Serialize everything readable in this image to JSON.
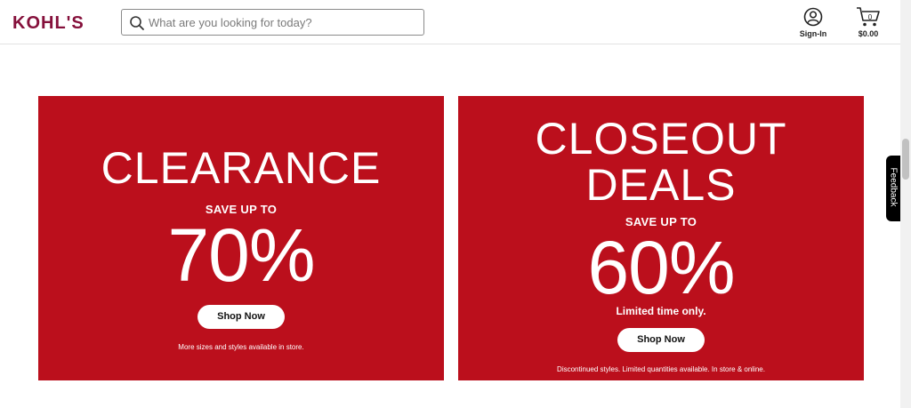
{
  "header": {
    "logo_text": "KOHL'S",
    "search_placeholder": "What are you looking for today?",
    "search_value": "",
    "signin_label": "Sign-In",
    "cart_count": "0",
    "cart_total": "$0.00"
  },
  "promos": [
    {
      "headline_lines": [
        "CLEARANCE"
      ],
      "save_label": "SAVE UP TO",
      "percent": "70%",
      "sub_label": "",
      "button_label": "Shop Now",
      "fine_print": "More sizes and styles available in store."
    },
    {
      "headline_lines": [
        "CLOSEOUT",
        "DEALS"
      ],
      "save_label": "SAVE UP TO",
      "percent": "60%",
      "sub_label": "Limited time only.",
      "button_label": "Shop Now",
      "fine_print": "Discontinued styles. Limited quantities available. In store & online."
    }
  ],
  "feedback_label": "Feedback",
  "colors": {
    "brand": "#85103b",
    "promo_red": "#bb0f1c"
  }
}
